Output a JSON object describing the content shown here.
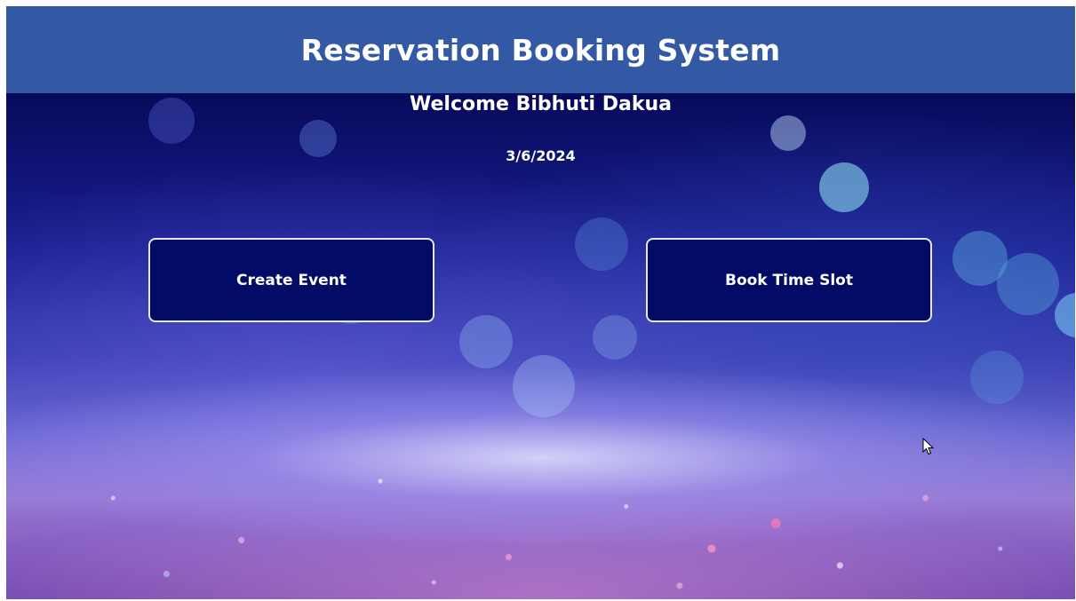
{
  "header": {
    "title": "Reservation Booking System"
  },
  "main": {
    "welcome_text": "Welcome Bibhuti Dakua",
    "date_text": "3/6/2024"
  },
  "actions": {
    "create_event_label": "Create Event",
    "book_time_slot_label": "Book Time Slot"
  },
  "icons": {
    "cursor": "mouse-pointer-icon"
  },
  "colors": {
    "header_background": "#3358a4",
    "button_background": "#020c66",
    "button_border": "#e8e8f4",
    "text": "#ffffff"
  }
}
